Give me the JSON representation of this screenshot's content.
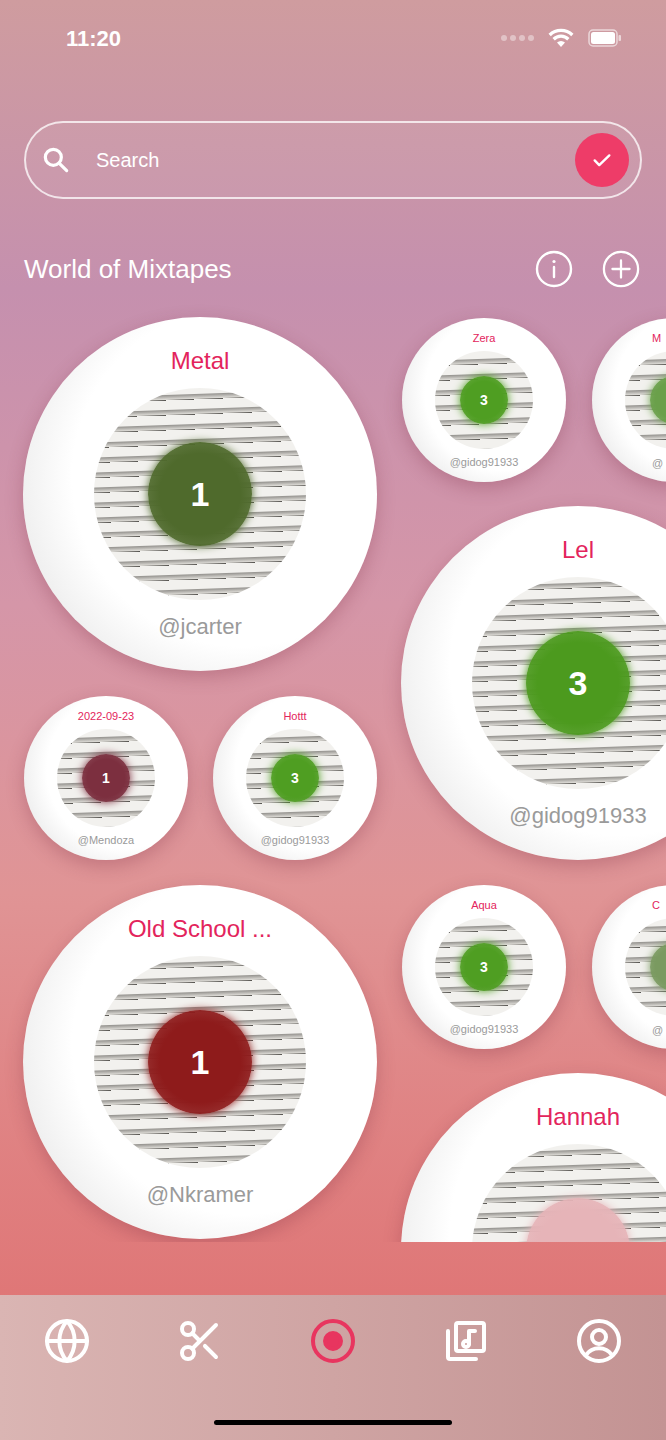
{
  "status_bar": {
    "time": "11:20"
  },
  "search": {
    "placeholder": "Search"
  },
  "section": {
    "title": "World of Mixtapes"
  },
  "mixtapes": [
    {
      "kind": "large",
      "title": "Metal",
      "handle": "@jcarter",
      "badge": "1",
      "color": "#4f6a2c"
    },
    {
      "kind": "small",
      "title": "Zera",
      "handle": "@gidog91933",
      "badge": "3",
      "color": "#4f9e22"
    },
    {
      "kind": "partial",
      "title": "M",
      "handle": "@",
      "color": "#6aa04a"
    },
    {
      "kind": "large",
      "title": "Lel",
      "handle": "@gidog91933",
      "badge": "3",
      "color": "#4c9a1e"
    },
    {
      "kind": "small",
      "title": "2022-09-23",
      "handle": "@Mendoza",
      "badge": "1",
      "color": "#7c2f3f"
    },
    {
      "kind": "small",
      "title": "Hottt",
      "handle": "@gidog91933",
      "badge": "3",
      "color": "#4f9e22"
    },
    {
      "kind": "large",
      "title": "Old School ...",
      "handle": "@Nkramer",
      "badge": "1",
      "color": "#8e1b1b"
    },
    {
      "kind": "small",
      "title": "Aqua",
      "handle": "@gidog91933",
      "badge": "3",
      "color": "#4f9e22"
    },
    {
      "kind": "partial",
      "title": "C",
      "handle": "@",
      "color": "#7a9a60"
    },
    {
      "kind": "large",
      "title": "Hannah",
      "color": "#e6b4b8"
    }
  ],
  "nav": [
    {
      "selected": false
    },
    {
      "selected": false
    },
    {
      "selected": true
    },
    {
      "selected": false
    },
    {
      "selected": false
    }
  ]
}
